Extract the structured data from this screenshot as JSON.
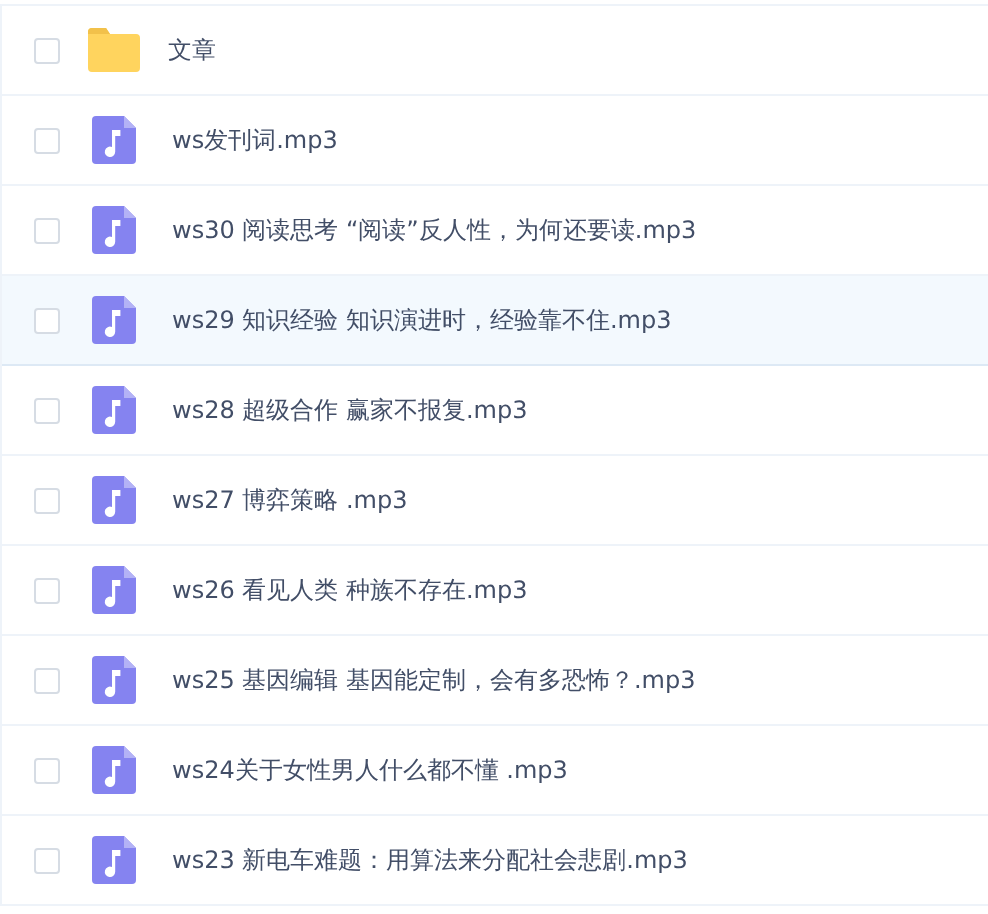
{
  "files": [
    {
      "kind": "folder",
      "name": "文章",
      "checked": false,
      "selected": false
    },
    {
      "kind": "audio",
      "name": "ws发刊词.mp3",
      "checked": false,
      "selected": false
    },
    {
      "kind": "audio",
      "name": "ws30 阅读思考 “阅读”反人性，为何还要读.mp3",
      "checked": false,
      "selected": false
    },
    {
      "kind": "audio",
      "name": "ws29 知识经验 知识演进时，经验靠不住.mp3",
      "checked": false,
      "selected": true
    },
    {
      "kind": "audio",
      "name": "ws28 超级合作 赢家不报复.mp3",
      "checked": false,
      "selected": false
    },
    {
      "kind": "audio",
      "name": "ws27 博弈策略 .mp3",
      "checked": false,
      "selected": false
    },
    {
      "kind": "audio",
      "name": "ws26 看见人类 种族不存在.mp3",
      "checked": false,
      "selected": false
    },
    {
      "kind": "audio",
      "name": "ws25 基因编辑 基因能定制，会有多恐怖？.mp3",
      "checked": false,
      "selected": false
    },
    {
      "kind": "audio",
      "name": "ws24关于女性男人什么都不懂 .mp3",
      "checked": false,
      "selected": false
    },
    {
      "kind": "audio",
      "name": "ws23 新电车难题：用算法来分配社会悲剧.mp3",
      "checked": false,
      "selected": false
    }
  ]
}
